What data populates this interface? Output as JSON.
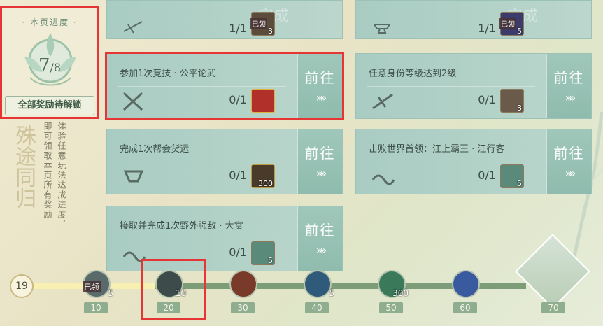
{
  "progress_panel": {
    "title": "· 本页进度 ·",
    "current": "7",
    "total": "/8",
    "unlock_label": "全部奖励待解锁"
  },
  "side_text": {
    "calligraphy": "殊途同归",
    "description": "体验任意玩法达成进度，即可领取本页所有奖励"
  },
  "tasks": [
    {
      "id": "top-left",
      "title": "",
      "count": "1/1",
      "reward_badge": "已领",
      "reward_qty": "3",
      "stamp": "完成"
    },
    {
      "id": "top-right",
      "title": "",
      "count": "1/1",
      "reward_badge": "已领",
      "reward_qty": "5",
      "stamp": "完成"
    },
    {
      "id": "task-arena",
      "title": "参加1次竞技 · 公平论武",
      "count": "0/1",
      "reward_qty": "",
      "goto": "前往",
      "chev": "»»"
    },
    {
      "id": "task-level",
      "title": "任意身份等级达到2级",
      "count": "0/1",
      "reward_qty": "3",
      "goto": "前往",
      "chev": "»»"
    },
    {
      "id": "task-freight",
      "title": "完成1次帮会货运",
      "count": "0/1",
      "reward_qty": "300",
      "goto": "前往",
      "chev": "»»"
    },
    {
      "id": "task-boss",
      "title": "击败世界首领：江上霸王 · 江行客",
      "count": "0/1",
      "reward_qty": "5",
      "goto": "前往",
      "chev": "»»"
    },
    {
      "id": "task-bounty",
      "title": "接取并完成1次野外强敌 · 大赏",
      "count": "0/1",
      "reward_qty": "5",
      "goto": "前往",
      "chev": "»»"
    }
  ],
  "track": {
    "current_level": "19",
    "nodes": [
      {
        "milestone": "10",
        "qty": "5",
        "badge": "已领"
      },
      {
        "milestone": "20",
        "qty": "10",
        "badge": ""
      },
      {
        "milestone": "30",
        "qty": "",
        "badge": ""
      },
      {
        "milestone": "40",
        "qty": "5",
        "badge": ""
      },
      {
        "milestone": "50",
        "qty": "300",
        "badge": ""
      },
      {
        "milestone": "60",
        "qty": "",
        "badge": ""
      },
      {
        "milestone": "70",
        "qty": "",
        "badge": ""
      }
    ]
  },
  "colors": {
    "highlight": "#e53535",
    "card": "#a9ccc2",
    "accent": "#4a6a56"
  }
}
